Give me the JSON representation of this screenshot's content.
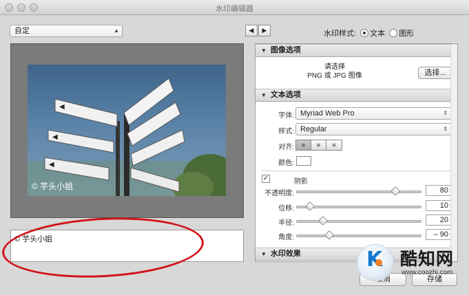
{
  "window": {
    "title": "水印编辑器"
  },
  "preset": {
    "value": "自定"
  },
  "watermark_style": {
    "label": "水印样式:",
    "options": [
      "文本",
      "图形"
    ],
    "selected": "文本"
  },
  "preview": {
    "watermark_text": "© 芋头小姐"
  },
  "text_input": {
    "value": "© 芋头小姐"
  },
  "image_options": {
    "title": "图像选项",
    "hint_line1": "请选择",
    "hint_line2": "PNG 或 JPG 图像",
    "choose_button": "选择..."
  },
  "text_options": {
    "title": "文本选项",
    "font_label": "字体:",
    "font_value": "Myriad Web Pro",
    "style_label": "样式:",
    "style_value": "Regular",
    "align_label": "对齐:",
    "align_selected": "left",
    "color_label": "颜色:",
    "color_value": "#ffffff"
  },
  "shadow": {
    "label": "阴影",
    "enabled": true,
    "check_mark": "✓",
    "opacity_label": "不透明度:",
    "opacity_value": "80",
    "offset_label": "位移:",
    "offset_value": "10",
    "radius_label": "半径:",
    "radius_value": "20",
    "angle_label": "角度:",
    "angle_value": "– 90"
  },
  "watermark_effects": {
    "title": "水印效果"
  },
  "footer": {
    "cancel": "取消",
    "save": "存储"
  },
  "site_logo": {
    "name": "酷知网",
    "url": "www.coozhi.com"
  },
  "colors": {
    "annotation_red": "#d1121a",
    "logo_blue": "#1479cc",
    "logo_orange": "#f4801f"
  }
}
